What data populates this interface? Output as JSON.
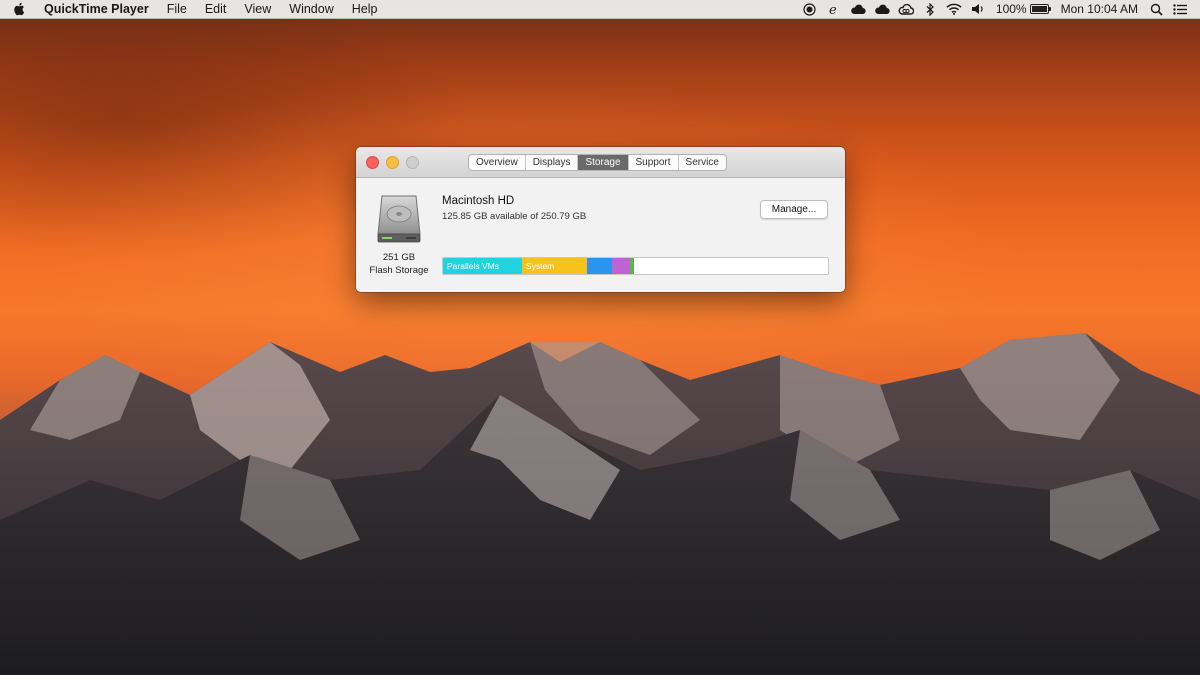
{
  "menubar": {
    "app_name": "QuickTime Player",
    "menus": [
      "File",
      "Edit",
      "View",
      "Window",
      "Help"
    ],
    "battery_percent_label": "100%",
    "battery_level": 1.0,
    "clock": "Mon 10:04 AM",
    "status_icons": [
      "record-icon",
      "edge-icon",
      "cloud-icon",
      "cloud-icon",
      "creative-cloud-icon",
      "bluetooth-icon",
      "wifi-icon",
      "volume-icon"
    ]
  },
  "window": {
    "tabs": [
      {
        "label": "Overview",
        "active": false
      },
      {
        "label": "Displays",
        "active": false
      },
      {
        "label": "Storage",
        "active": true
      },
      {
        "label": "Support",
        "active": false
      },
      {
        "label": "Service",
        "active": false
      }
    ],
    "disk": {
      "name": "Macintosh HD",
      "available_text": "125.85 GB available of 250.79 GB",
      "size": "251 GB",
      "type": "Flash Storage",
      "manage_label": "Manage..."
    },
    "storage_segments": [
      {
        "label": "Parallels VMs",
        "fraction": 0.205,
        "color": "#1fd3e0"
      },
      {
        "label": "System",
        "fraction": 0.17,
        "color": "#f7c21b"
      },
      {
        "label": "",
        "fraction": 0.063,
        "color": "#2a94ee"
      },
      {
        "label": "",
        "fraction": 0.047,
        "color": "#c063d2"
      },
      {
        "label": "",
        "fraction": 0.007,
        "color": "#57b846"
      }
    ]
  },
  "colors": {
    "free_space": "#ffffff",
    "active_tab": "#6a6a6a"
  }
}
